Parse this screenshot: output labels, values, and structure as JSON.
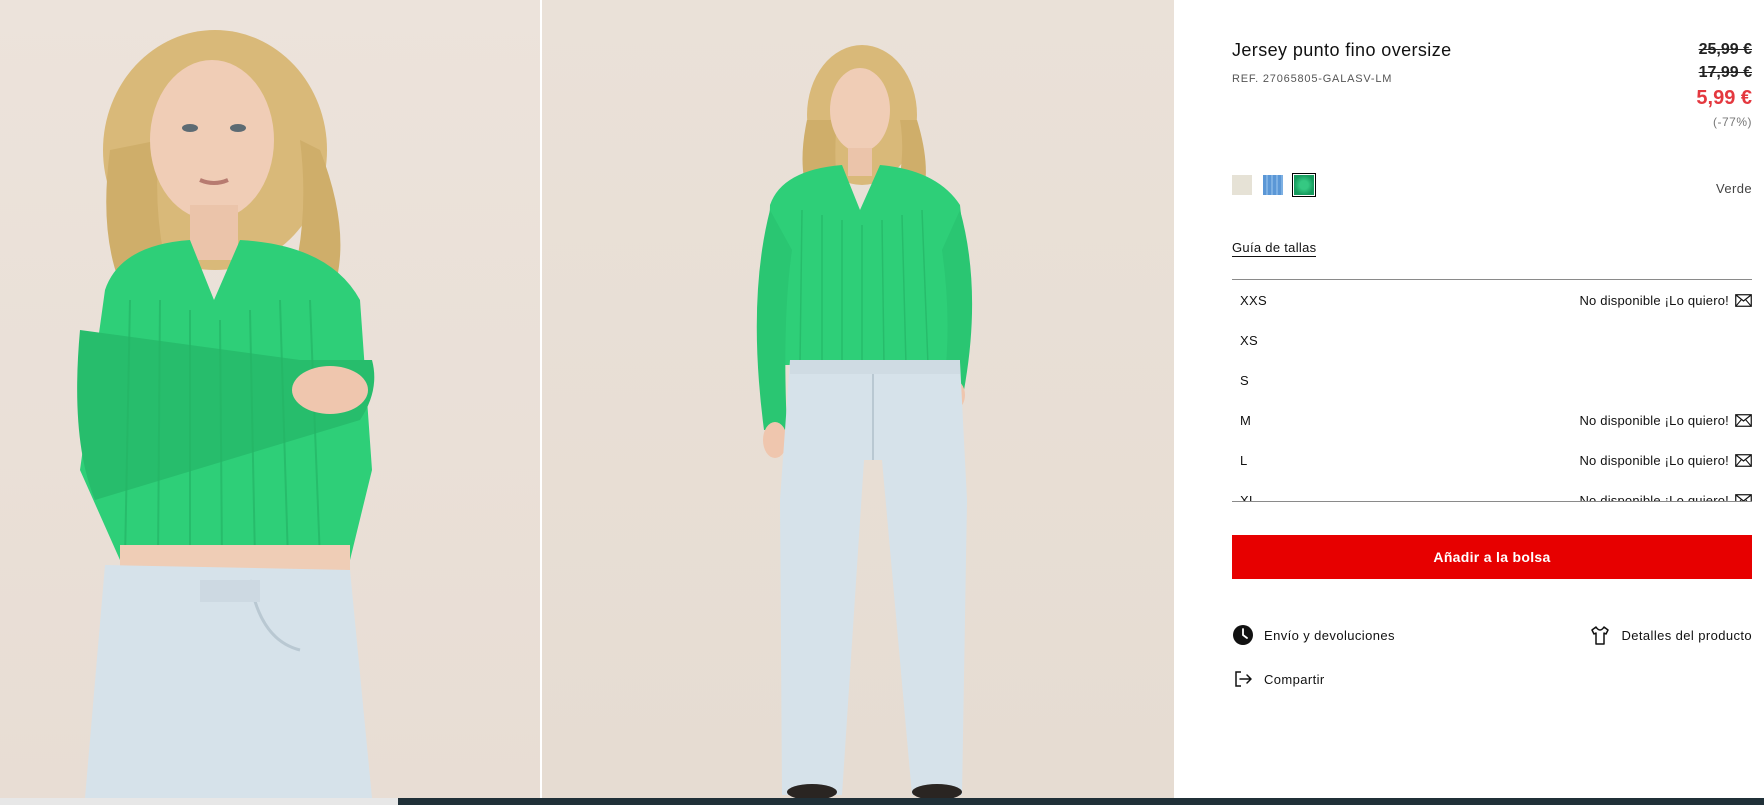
{
  "gallery": {
    "images": [
      {
        "name": "model-closeup-photo",
        "alt": ""
      },
      {
        "name": "model-fullbody-photo",
        "alt": ""
      }
    ]
  },
  "product": {
    "title": "Jersey punto fino oversize",
    "ref": "REF. 27065805-GALASV-LM",
    "prices": {
      "original": "25,99 €",
      "previous": "17,99 €",
      "current": "5,99 €",
      "discount": "(-77%)"
    },
    "colors": {
      "swatches": [
        {
          "name": "swatch-ecru",
          "color": "#e6e2d6"
        },
        {
          "name": "swatch-blue",
          "color": "#5b97d6"
        },
        {
          "name": "swatch-green",
          "color": "#1fa66a",
          "selected": true
        }
      ],
      "selected_label": "Verde"
    },
    "size_guide": "Guía de tallas",
    "sizes": [
      {
        "label": "XXS",
        "status": "No disponible ¡Lo quiero!",
        "available": false
      },
      {
        "label": "XS",
        "status": "",
        "available": true
      },
      {
        "label": "S",
        "status": "",
        "available": true
      },
      {
        "label": "M",
        "status": "No disponible ¡Lo quiero!",
        "available": false
      },
      {
        "label": "L",
        "status": "No disponible ¡Lo quiero!",
        "available": false
      },
      {
        "label": "XL",
        "status": "No disponible ¡Lo quiero!",
        "available": false
      }
    ],
    "add_to_bag": "Añadir a la bolsa",
    "links": {
      "shipping": "Envío y devoluciones",
      "details": "Detalles del producto",
      "share": "Compartir"
    }
  },
  "colors": {
    "accent_red": "#e70000",
    "sale_red": "#e4383f",
    "sweater_green": "#2ecf78",
    "jeans": "#d6e2ea"
  }
}
